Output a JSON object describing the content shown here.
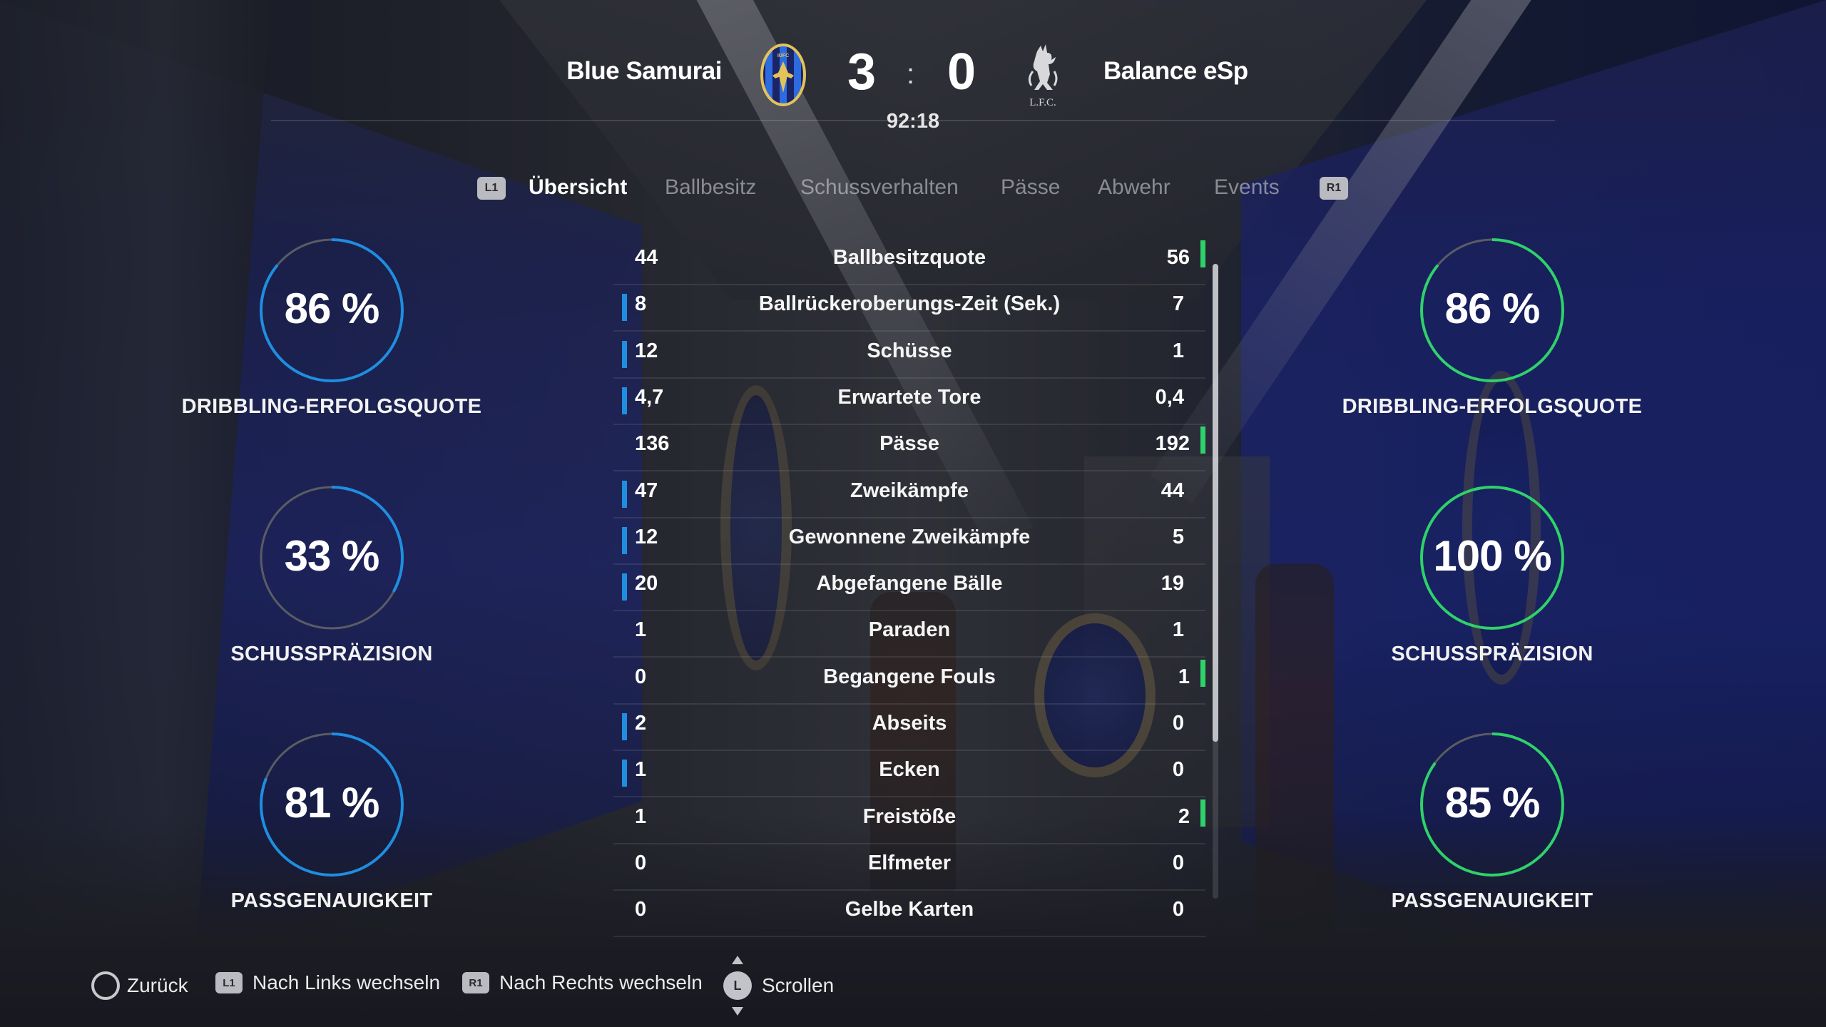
{
  "match": {
    "home_team": "Blue Samurai",
    "away_team": "Balance eSp",
    "home_score": "3",
    "away_score": "0",
    "separator": ":",
    "clock": "92:18",
    "away_crest_text": "L.F.C.",
    "home_crest_text": "IUFC"
  },
  "tabs": {
    "left_button": "L1",
    "right_button": "R1",
    "items": [
      "Übersicht",
      "Ballbesitz",
      "Schussverhalten",
      "Pässe",
      "Abwehr",
      "Events"
    ],
    "active": "Übersicht"
  },
  "rings": {
    "home": [
      {
        "value": "86 %",
        "label": "DRIBBLING-ERFOLGSQUOTE",
        "fraction": 0.86
      },
      {
        "value": "33 %",
        "label": "SCHUSSPRÄZISION",
        "fraction": 0.33
      },
      {
        "value": "81 %",
        "label": "PASSGENAUIGKEIT",
        "fraction": 0.81
      }
    ],
    "away": [
      {
        "value": "86 %",
        "label": "DRIBBLING-ERFOLGSQUOTE",
        "fraction": 0.86
      },
      {
        "value": "100 %",
        "label": "SCHUSSPRÄZISION",
        "fraction": 1.0
      },
      {
        "value": "85 %",
        "label": "PASSGENAUIGKEIT",
        "fraction": 0.85
      }
    ],
    "home_color": "#1f8ee0",
    "away_color": "#2fd16a",
    "track_color": "#5a5c64"
  },
  "stats": [
    {
      "name": "Ballbesitzquote",
      "home": "44",
      "away": "56",
      "leader": "away"
    },
    {
      "name": "Ballrückeroberungs-Zeit (Sek.)",
      "home": "8",
      "away": "7",
      "leader": "home"
    },
    {
      "name": "Schüsse",
      "home": "12",
      "away": "1",
      "leader": "home"
    },
    {
      "name": "Erwartete Tore",
      "home": "4,7",
      "away": "0,4",
      "leader": "home"
    },
    {
      "name": "Pässe",
      "home": "136",
      "away": "192",
      "leader": "away"
    },
    {
      "name": "Zweikämpfe",
      "home": "47",
      "away": "44",
      "leader": "home"
    },
    {
      "name": "Gewonnene Zweikämpfe",
      "home": "12",
      "away": "5",
      "leader": "home"
    },
    {
      "name": "Abgefangene Bälle",
      "home": "20",
      "away": "19",
      "leader": "home"
    },
    {
      "name": "Paraden",
      "home": "1",
      "away": "1",
      "leader": "none"
    },
    {
      "name": "Begangene Fouls",
      "home": "0",
      "away": "1",
      "leader": "away"
    },
    {
      "name": "Abseits",
      "home": "2",
      "away": "0",
      "leader": "home"
    },
    {
      "name": "Ecken",
      "home": "1",
      "away": "0",
      "leader": "home"
    },
    {
      "name": "Freistöße",
      "home": "1",
      "away": "2",
      "leader": "away"
    },
    {
      "name": "Elfmeter",
      "home": "0",
      "away": "0",
      "leader": "none"
    },
    {
      "name": "Gelbe Karten",
      "home": "0",
      "away": "0",
      "leader": "none"
    }
  ],
  "colors": {
    "home_bar": "#1f8ee0",
    "away_bar": "#2fd16a"
  },
  "footer": {
    "back_icon": "circle-button-icon",
    "back_label": "Zurück",
    "left_button": "L1",
    "left_label": "Nach Links wechseln",
    "right_button": "R1",
    "right_label": "Nach Rechts wechseln",
    "stick_button": "L",
    "scroll_label": "Scrollen"
  }
}
